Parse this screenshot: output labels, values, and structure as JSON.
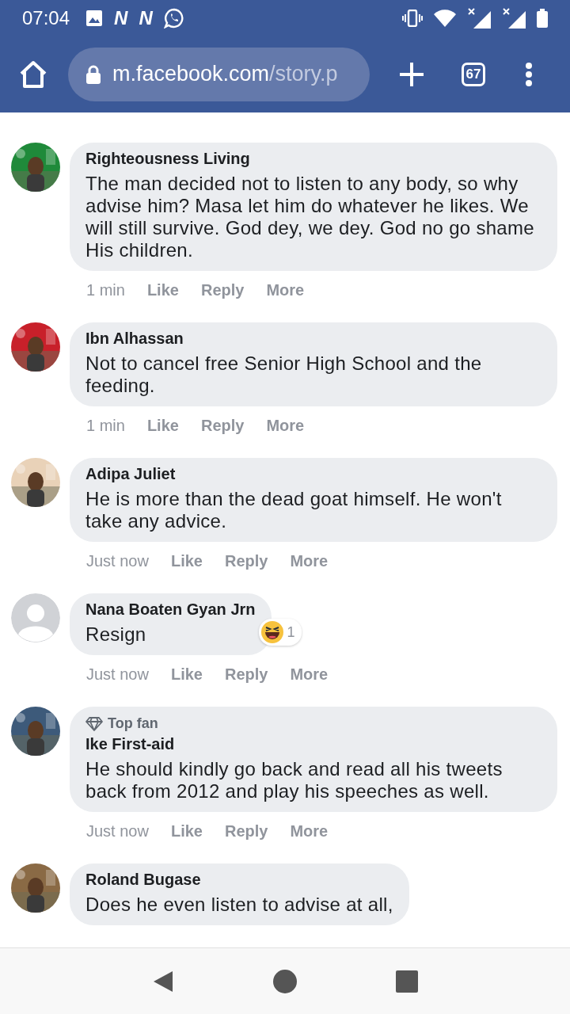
{
  "status_bar": {
    "time": "07:04",
    "app_badges": [
      "N",
      "N"
    ]
  },
  "browser": {
    "url_host": "m.facebook.com",
    "url_path": "/story.p",
    "tab_count": "67"
  },
  "comments": [
    {
      "author": "Righteousness Living",
      "text": "The man decided not to listen to any body, so why advise him? Masa let him do whatever he likes. We will still survive. God dey, we dey. God no go shame His children.",
      "time": "1 min",
      "actions": [
        "Like",
        "Reply",
        "More"
      ]
    },
    {
      "author": "Ibn Alhassan",
      "text": "Not to cancel free Senior High School and the feeding.",
      "time": "1 min",
      "actions": [
        "Like",
        "Reply",
        "More"
      ]
    },
    {
      "author": "Adipa Juliet",
      "text": "He is more than the dead goat himself. He won't take any advice.",
      "time": "Just now",
      "actions": [
        "Like",
        "Reply",
        "More"
      ]
    },
    {
      "author": "Nana Boaten Gyan Jrn",
      "avatar": {
        "kind": "default"
      },
      "text": "Resign",
      "reaction_count": "1",
      "time": "Just now",
      "actions": [
        "Like",
        "Reply",
        "More"
      ]
    },
    {
      "author": "Ike First-aid",
      "badge": "Top fan",
      "text": "He should kindly go back and read all his tweets back from 2012 and play his speeches as well.",
      "time": "Just now",
      "actions": [
        "Like",
        "Reply",
        "More"
      ]
    },
    {
      "author": "Roland Bugase",
      "text": "Does he even listen to advise at all,"
    }
  ]
}
